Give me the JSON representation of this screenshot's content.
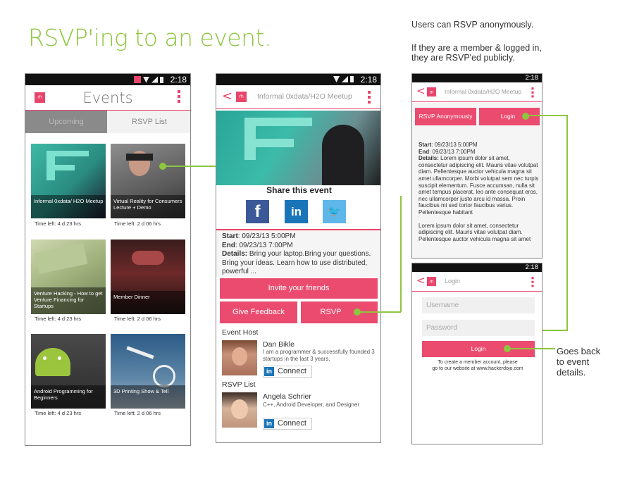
{
  "heading": "RSVP'ing to an event.",
  "notes": {
    "anon": "Users can RSVP anonymously.",
    "member_1": "If they are a member & logged in,",
    "member_2": "they are RSVP'ed publicly.",
    "back_1": "Goes back",
    "back_2": "to event",
    "back_3": "details."
  },
  "status": {
    "time": "2:18"
  },
  "colors": {
    "accent": "#ea4b6f",
    "annotation": "#8dc63f"
  },
  "logo_glyph": "⫙",
  "screen1": {
    "title": "Events",
    "tabs": [
      "Upcoming",
      "RSVP List"
    ],
    "events": [
      {
        "title": "Informal 0xdata/ H2O Meetup",
        "time_left": "Time left: 4 d 23 hrs"
      },
      {
        "title": "Virtual Reality for Consumers Lecture + Demo",
        "time_left": "Time left: 2 d 06 hrs"
      },
      {
        "title": "Venture Hacking - How to get Venture Financing for Startups",
        "time_left": "Time left: 4 d 23 hrs"
      },
      {
        "title": "Member Dinner",
        "time_left": "Time left: 2 d 06 hrs"
      },
      {
        "title": "Android Programming for Beginners",
        "time_left": "Time left: 4 d 23 hrs"
      },
      {
        "title": "3D Printing Show & Tell",
        "time_left": "Time left: 2 d 06 hrs"
      }
    ]
  },
  "screen2": {
    "title": "Informal 0xdata/H2O Meetup",
    "share_title": "Share this event",
    "social": {
      "facebook": "f",
      "linkedin": "in",
      "twitter": "🐦"
    },
    "start_label": "Start",
    "start_value": ":  09/23/13 5:00PM",
    "end_label": "End",
    "end_value": ":   09/23/13 7:00PM",
    "details_label": "Details:",
    "details_value": "Bring your laptop.Bring your questions. Bring your ideas. Learn how to use distributed, powerful ...",
    "invite_button": "Invite your friends",
    "feedback_button": "Give Feedback",
    "rsvp_button": "RSVP",
    "host_heading": "Event Host",
    "host": {
      "name": "Dan Bikle",
      "bio": "I am a programmer & successfully founded 3 startups in the last 3 years."
    },
    "rsvp_heading": "RSVP List",
    "attendee": {
      "name": "Angela Schrier",
      "bio": "C++, Android Developer, and Designer"
    },
    "connect_label": "Connect",
    "li_glyph": "in"
  },
  "screen3": {
    "title": "Informal 0xdata/H2O Meetup",
    "anon_button": "RSVP Anonymously",
    "login_button": "Login",
    "start_label": "Start",
    "start_value": ":  09/23/13 5:00PM",
    "end_label": "End",
    "end_value": ":   09/23/13 7:00PM",
    "details_label": "Details:",
    "details_value": "Lorem ipsum dolor sit amet, consectetur adipiscing elit. Mauris vitae volutpat diam. Pellentesque auctor vehicula magna sit amet ullamcorper. Morbi volutpat sem nec turpis suscipit elementum. Fusce accumsan, nulla sit amet tempus placerat, leo ante consequat eros, nec ullamcorper justo arcu id massa. Proin faucibus mi sed tortor faucibus varius. Pellentesque habitant",
    "para2": "Lorem ipsum dolor sit amet, consectetur adipiscing elit. Mauris vitae volutpat diam. Pellentesque auctor vehicula magna sit amet"
  },
  "screen4": {
    "title": "Login",
    "username_placeholder": "Username",
    "password_placeholder": "Password",
    "login_button": "Login",
    "footer_1": "To create a member account, please",
    "footer_2": "go to our website at www.hackerdojo.com"
  }
}
